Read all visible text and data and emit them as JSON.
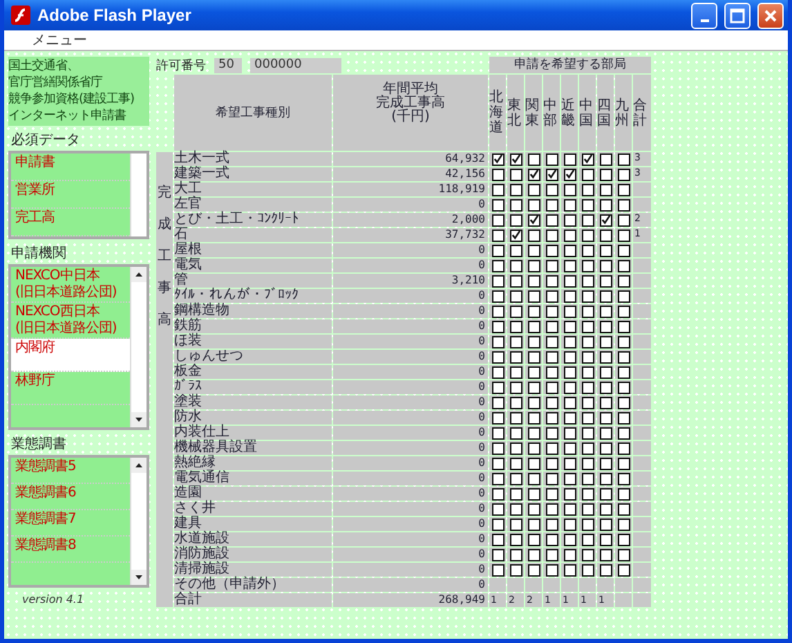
{
  "window": {
    "title": "Adobe Flash Player"
  },
  "menu": [
    "メニュー"
  ],
  "sidebar": {
    "heading_lines": [
      "国土交通省、",
      "官庁営繕関係省庁",
      "競争参加資格(建設工事)",
      "インターネット申請書"
    ],
    "sections": [
      {
        "label": "必須データ",
        "scrollbar": false,
        "items": [
          {
            "text": "申請書",
            "done": true
          },
          {
            "text": "営業所",
            "done": true
          },
          {
            "text": "完工高",
            "done": true
          }
        ]
      },
      {
        "label": "申請機関",
        "scrollbar": true,
        "items": [
          {
            "text": "NEXCO中日本 (旧日本道路公団)",
            "done": true
          },
          {
            "text": "NEXCO西日本 (旧日本道路公団)",
            "done": true
          },
          {
            "text": "内閣府",
            "done": false
          },
          {
            "text": "林野庁",
            "done": true
          },
          {
            "done": true
          }
        ]
      },
      {
        "label": "業態調書",
        "scrollbar": true,
        "items": [
          {
            "text": "業態調書5",
            "done": true
          },
          {
            "text": "業態調書6",
            "done": true
          },
          {
            "text": "業態調書7",
            "done": true
          },
          {
            "text": "業態調書8",
            "done": true
          },
          {
            "done": true
          }
        ]
      }
    ],
    "version": "version 4.1"
  },
  "permit": {
    "label": "許可番号",
    "prefix": "50",
    "number": "000000"
  },
  "table": {
    "group_heading": "申請を希望する部局",
    "name_heading": "希望工事種別",
    "amount_heading": [
      "年間平均",
      "完成工事高",
      "(千円)"
    ],
    "regions": [
      "北海道",
      "東北",
      "関東",
      "中部",
      "近畿",
      "中国",
      "四国",
      "九州"
    ],
    "count_heading": "合計",
    "side_label": "完成工事高",
    "rows": [
      {
        "kind": "check",
        "name": "土木一式",
        "amount": "64,932",
        "checks": [
          true,
          true,
          false,
          false,
          false,
          true,
          false,
          false
        ],
        "count": "3"
      },
      {
        "kind": "check",
        "name": "建築一式",
        "amount": "42,156",
        "checks": [
          false,
          false,
          true,
          true,
          true,
          false,
          false,
          false
        ],
        "count": "3"
      },
      {
        "kind": "check",
        "name": "大工",
        "amount": "118,919",
        "checks": [
          false,
          false,
          false,
          false,
          false,
          false,
          false,
          false
        ]
      },
      {
        "kind": "check",
        "name": "左官",
        "amount": "0",
        "checks": [
          false,
          false,
          false,
          false,
          false,
          false,
          false,
          false
        ]
      },
      {
        "kind": "check",
        "name": "とび・土工・ｺﾝｸﾘｰﾄ",
        "amount": "2,000",
        "checks": [
          false,
          false,
          true,
          false,
          false,
          false,
          true,
          false
        ],
        "count": "2"
      },
      {
        "kind": "check",
        "name": "石",
        "amount": "37,732",
        "checks": [
          false,
          true,
          false,
          false,
          false,
          false,
          false,
          false
        ],
        "count": "1"
      },
      {
        "kind": "check",
        "name": "屋根",
        "amount": "0",
        "checks": [
          false,
          false,
          false,
          false,
          false,
          false,
          false,
          false
        ]
      },
      {
        "kind": "check",
        "name": "電気",
        "amount": "0",
        "checks": [
          false,
          false,
          false,
          false,
          false,
          false,
          false,
          false
        ]
      },
      {
        "kind": "check",
        "name": "管",
        "amount": "3,210",
        "checks": [
          false,
          false,
          false,
          false,
          false,
          false,
          false,
          false
        ]
      },
      {
        "kind": "check",
        "name": "ﾀｲﾙ・れんが・ﾌﾞﾛｯｸ",
        "amount": "0",
        "checks": [
          false,
          false,
          false,
          false,
          false,
          false,
          false,
          false
        ]
      },
      {
        "kind": "check",
        "name": "鋼構造物",
        "amount": "0",
        "checks": [
          false,
          false,
          false,
          false,
          false,
          false,
          false,
          false
        ]
      },
      {
        "kind": "check",
        "name": "鉄筋",
        "amount": "0",
        "checks": [
          false,
          false,
          false,
          false,
          false,
          false,
          false,
          false
        ]
      },
      {
        "kind": "check",
        "name": "ほ装",
        "amount": "0",
        "checks": [
          false,
          false,
          false,
          false,
          false,
          false,
          false,
          false
        ]
      },
      {
        "kind": "check",
        "name": "しゅんせつ",
        "amount": "0",
        "checks": [
          false,
          false,
          false,
          false,
          false,
          false,
          false,
          false
        ]
      },
      {
        "kind": "check",
        "name": "板金",
        "amount": "0",
        "checks": [
          false,
          false,
          false,
          false,
          false,
          false,
          false,
          false
        ]
      },
      {
        "kind": "check",
        "name": "ｶﾞﾗｽ",
        "amount": "0",
        "checks": [
          false,
          false,
          false,
          false,
          false,
          false,
          false,
          false
        ]
      },
      {
        "kind": "check",
        "name": "塗装",
        "amount": "0",
        "checks": [
          false,
          false,
          false,
          false,
          false,
          false,
          false,
          false
        ]
      },
      {
        "kind": "check",
        "name": "防水",
        "amount": "0",
        "checks": [
          false,
          false,
          false,
          false,
          false,
          false,
          false,
          false
        ]
      },
      {
        "kind": "check",
        "name": "内装仕上",
        "amount": "0",
        "checks": [
          false,
          false,
          false,
          false,
          false,
          false,
          false,
          false
        ]
      },
      {
        "kind": "check",
        "name": "機械器具設置",
        "amount": "0",
        "checks": [
          false,
          false,
          false,
          false,
          false,
          false,
          false,
          false
        ]
      },
      {
        "kind": "check",
        "name": "熱絶縁",
        "amount": "0",
        "checks": [
          false,
          false,
          false,
          false,
          false,
          false,
          false,
          false
        ]
      },
      {
        "kind": "check",
        "name": "電気通信",
        "amount": "0",
        "checks": [
          false,
          false,
          false,
          false,
          false,
          false,
          false,
          false
        ]
      },
      {
        "kind": "check",
        "name": "造園",
        "amount": "0",
        "checks": [
          false,
          false,
          false,
          false,
          false,
          false,
          false,
          false
        ]
      },
      {
        "kind": "check",
        "name": "さく井",
        "amount": "0",
        "checks": [
          false,
          false,
          false,
          false,
          false,
          false,
          false,
          false
        ]
      },
      {
        "kind": "check",
        "name": "建具",
        "amount": "0",
        "checks": [
          false,
          false,
          false,
          false,
          false,
          false,
          false,
          false
        ]
      },
      {
        "kind": "check",
        "name": "水道施設",
        "amount": "0",
        "checks": [
          false,
          false,
          false,
          false,
          false,
          false,
          false,
          false
        ]
      },
      {
        "kind": "check",
        "name": "消防施設",
        "amount": "0",
        "checks": [
          false,
          false,
          false,
          false,
          false,
          false,
          false,
          false
        ]
      },
      {
        "kind": "check",
        "name": "清掃施設",
        "amount": "0",
        "checks": [
          false,
          false,
          false,
          false,
          false,
          false,
          false,
          false
        ]
      },
      {
        "kind": "plain",
        "name": "その他（申請外）",
        "amount": "0"
      }
    ],
    "total": {
      "name": "合計",
      "amount": "268,949",
      "region_counts": [
        "1",
        "2",
        "2",
        "1",
        "1",
        "1",
        "1"
      ]
    }
  }
}
